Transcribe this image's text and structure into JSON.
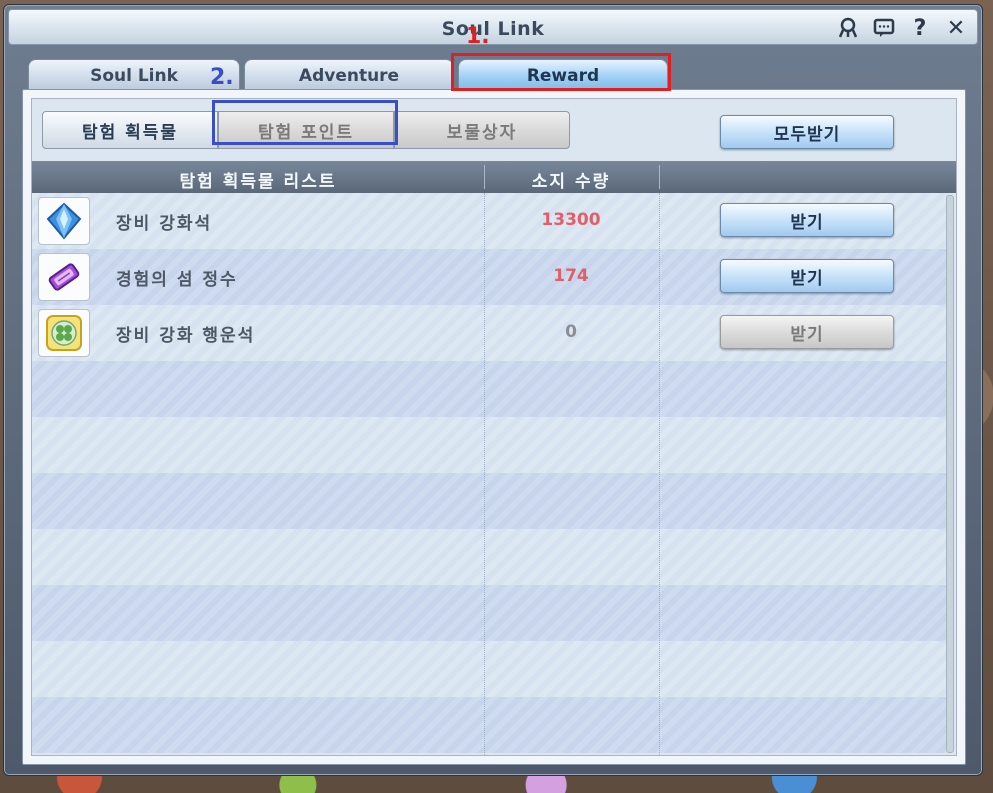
{
  "window": {
    "title": "Soul Link"
  },
  "tabs": [
    {
      "label": "Soul Link"
    },
    {
      "label": "Adventure"
    },
    {
      "label": "Reward"
    }
  ],
  "subtabs": [
    {
      "label": "탐험 획득물"
    },
    {
      "label": "탐험 포인트"
    },
    {
      "label": "보물상자"
    }
  ],
  "claim_all_label": "모두받기",
  "table": {
    "headers": [
      "탐험 획득물 리스트",
      "소지 수량"
    ],
    "rows": [
      {
        "name": "장비 강화석",
        "qty": "13300",
        "button": "받기",
        "icon": "blue-crystal-icon"
      },
      {
        "name": "경험의 섬 정수",
        "qty": "174",
        "button": "받기",
        "icon": "purple-essence-icon"
      },
      {
        "name": "장비 강화 행운석",
        "qty": "0",
        "button": "받기",
        "icon": "clover-stone-icon"
      }
    ]
  },
  "annotations": [
    {
      "label": "1.",
      "color": "#e02020"
    },
    {
      "label": "2.",
      "color": "#3a4ec8"
    }
  ],
  "colors": {
    "accent_red": "#e02020",
    "accent_blue": "#3a4ec8",
    "qty_red": "#e0606a",
    "qty_gray": "#8a8f96"
  }
}
